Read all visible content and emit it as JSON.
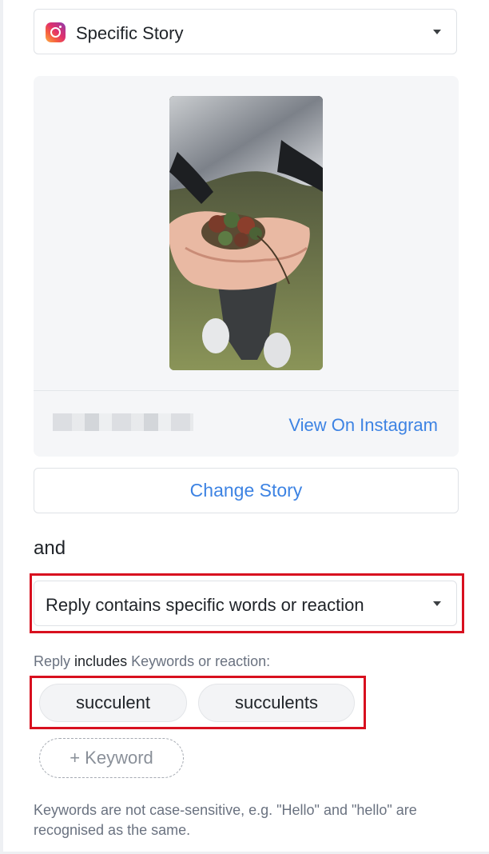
{
  "trigger": {
    "story_select_label": "Specific Story",
    "platform_icon": "instagram-icon"
  },
  "story_preview": {
    "image_alt": "Story image: cupped hands holding small succulents",
    "view_link": "View On Instagram"
  },
  "change_story_label": "Change Story",
  "connector_text": "and",
  "condition": {
    "select_label": "Reply contains specific words or reaction"
  },
  "reply_rule": {
    "prefix": "Reply",
    "operator": "includes",
    "suffix": "Keywords or reaction:"
  },
  "keywords": [
    "succulent",
    "succulents"
  ],
  "add_keyword_label": "+ Keyword",
  "help_text": "Keywords are not case-sensitive, e.g. \"Hello\" and \"hello\" are recognised as the same.",
  "colors": {
    "link": "#3d83e3",
    "highlight": "#d8101f",
    "card_bg": "#f5f6f8"
  }
}
